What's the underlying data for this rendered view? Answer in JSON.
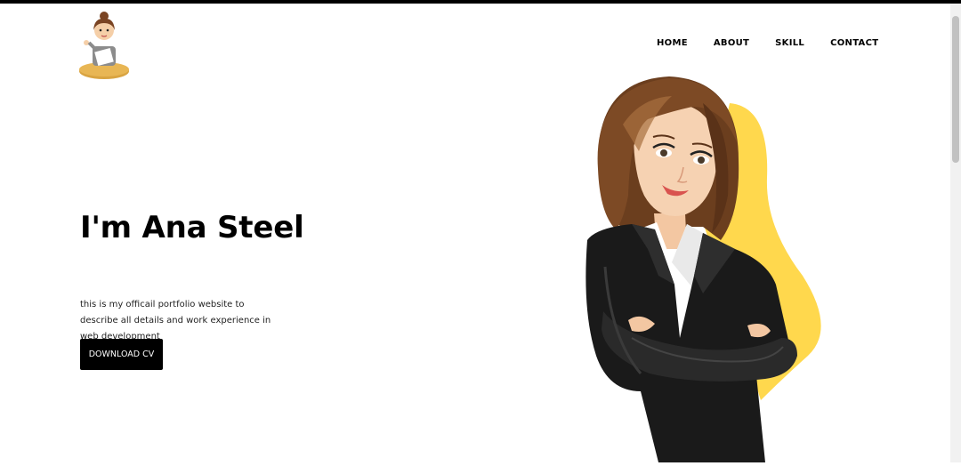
{
  "nav": {
    "items": [
      {
        "label": "HOME"
      },
      {
        "label": "ABOUT"
      },
      {
        "label": "SKILL"
      },
      {
        "label": "CONTACT"
      }
    ]
  },
  "hero": {
    "title": "I'm Ana Steel",
    "description": "this is my officail portfolio website to describe all details and work experience in web development",
    "button_label": "DOWNLOAD CV"
  },
  "colors": {
    "accent_yellow": "#FFD84D",
    "button_bg": "#000000",
    "button_text": "#FFFFFF",
    "hair_brown": "#6B3E1E",
    "suit_black": "#1A1A1A"
  },
  "icons": {
    "logo": "woman-at-desk-logo-icon",
    "illustration": "businesswoman-illustration"
  }
}
